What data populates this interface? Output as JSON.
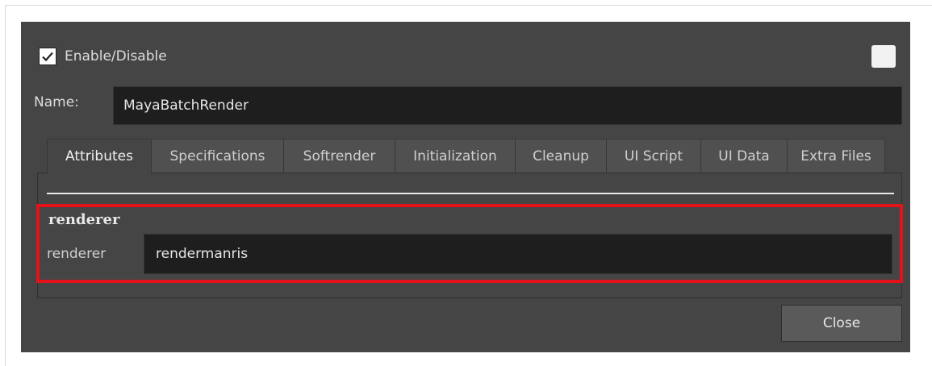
{
  "dialog": {
    "enable_label": "Enable/Disable",
    "enable_checked": true,
    "name_label": "Name:",
    "name_value": "MayaBatchRender"
  },
  "tabs": [
    {
      "label": "Attributes",
      "active": true
    },
    {
      "label": "Specifications",
      "active": false
    },
    {
      "label": "Softrender",
      "active": false
    },
    {
      "label": "Initialization",
      "active": false
    },
    {
      "label": "Cleanup",
      "active": false
    },
    {
      "label": "UI Script",
      "active": false
    },
    {
      "label": "UI Data",
      "active": false
    },
    {
      "label": "Extra Files",
      "active": false
    }
  ],
  "attributes": {
    "section_title": "renderer",
    "renderer_label": "renderer",
    "renderer_value": "rendermanris"
  },
  "buttons": {
    "close_label": "Close"
  },
  "colors": {
    "dialog_bg": "#454545",
    "field_bg": "#1e1e1e",
    "highlight": "#e4121b"
  }
}
